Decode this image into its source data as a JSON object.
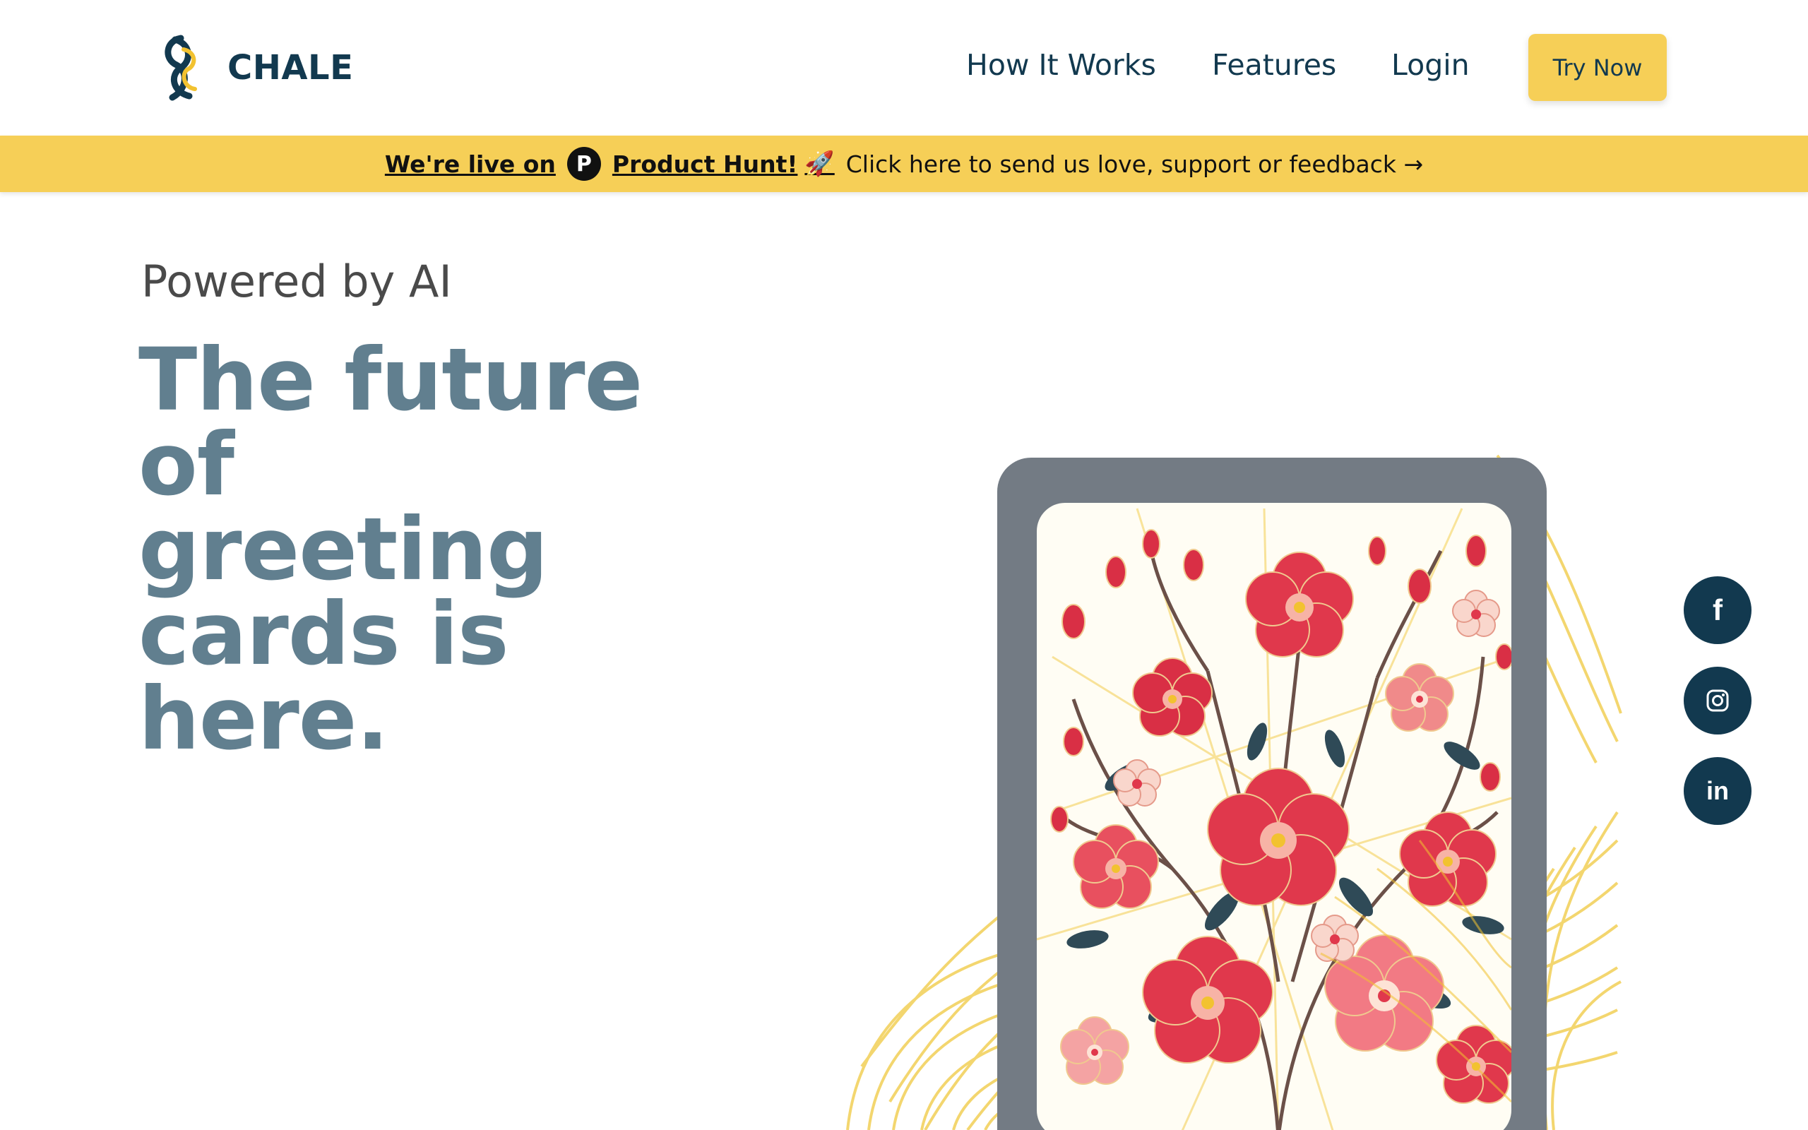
{
  "brand": {
    "name": "CHALE"
  },
  "nav": {
    "items": [
      {
        "label": "How It Works"
      },
      {
        "label": "Features"
      },
      {
        "label": "Login"
      }
    ],
    "cta_label": "Try Now"
  },
  "banner": {
    "prefix": "We're live on",
    "ph_letter": "P",
    "link": "Product Hunt!",
    "message": "Click here to send us love, support or feedback →"
  },
  "hero": {
    "eyebrow": "Powered by AI",
    "headline_lines": [
      "The future",
      "of",
      "greeting",
      "cards is",
      "here."
    ]
  },
  "social": [
    "facebook-icon",
    "instagram-icon",
    "linkedin-icon"
  ],
  "colors": {
    "brand_navy": "#12394f",
    "accent_yellow": "#f6cf57",
    "headline_slate": "#617f8f",
    "card_frame": "#737b84",
    "flower_red": "#e0384c",
    "leaf_dark": "#2f4a57"
  }
}
